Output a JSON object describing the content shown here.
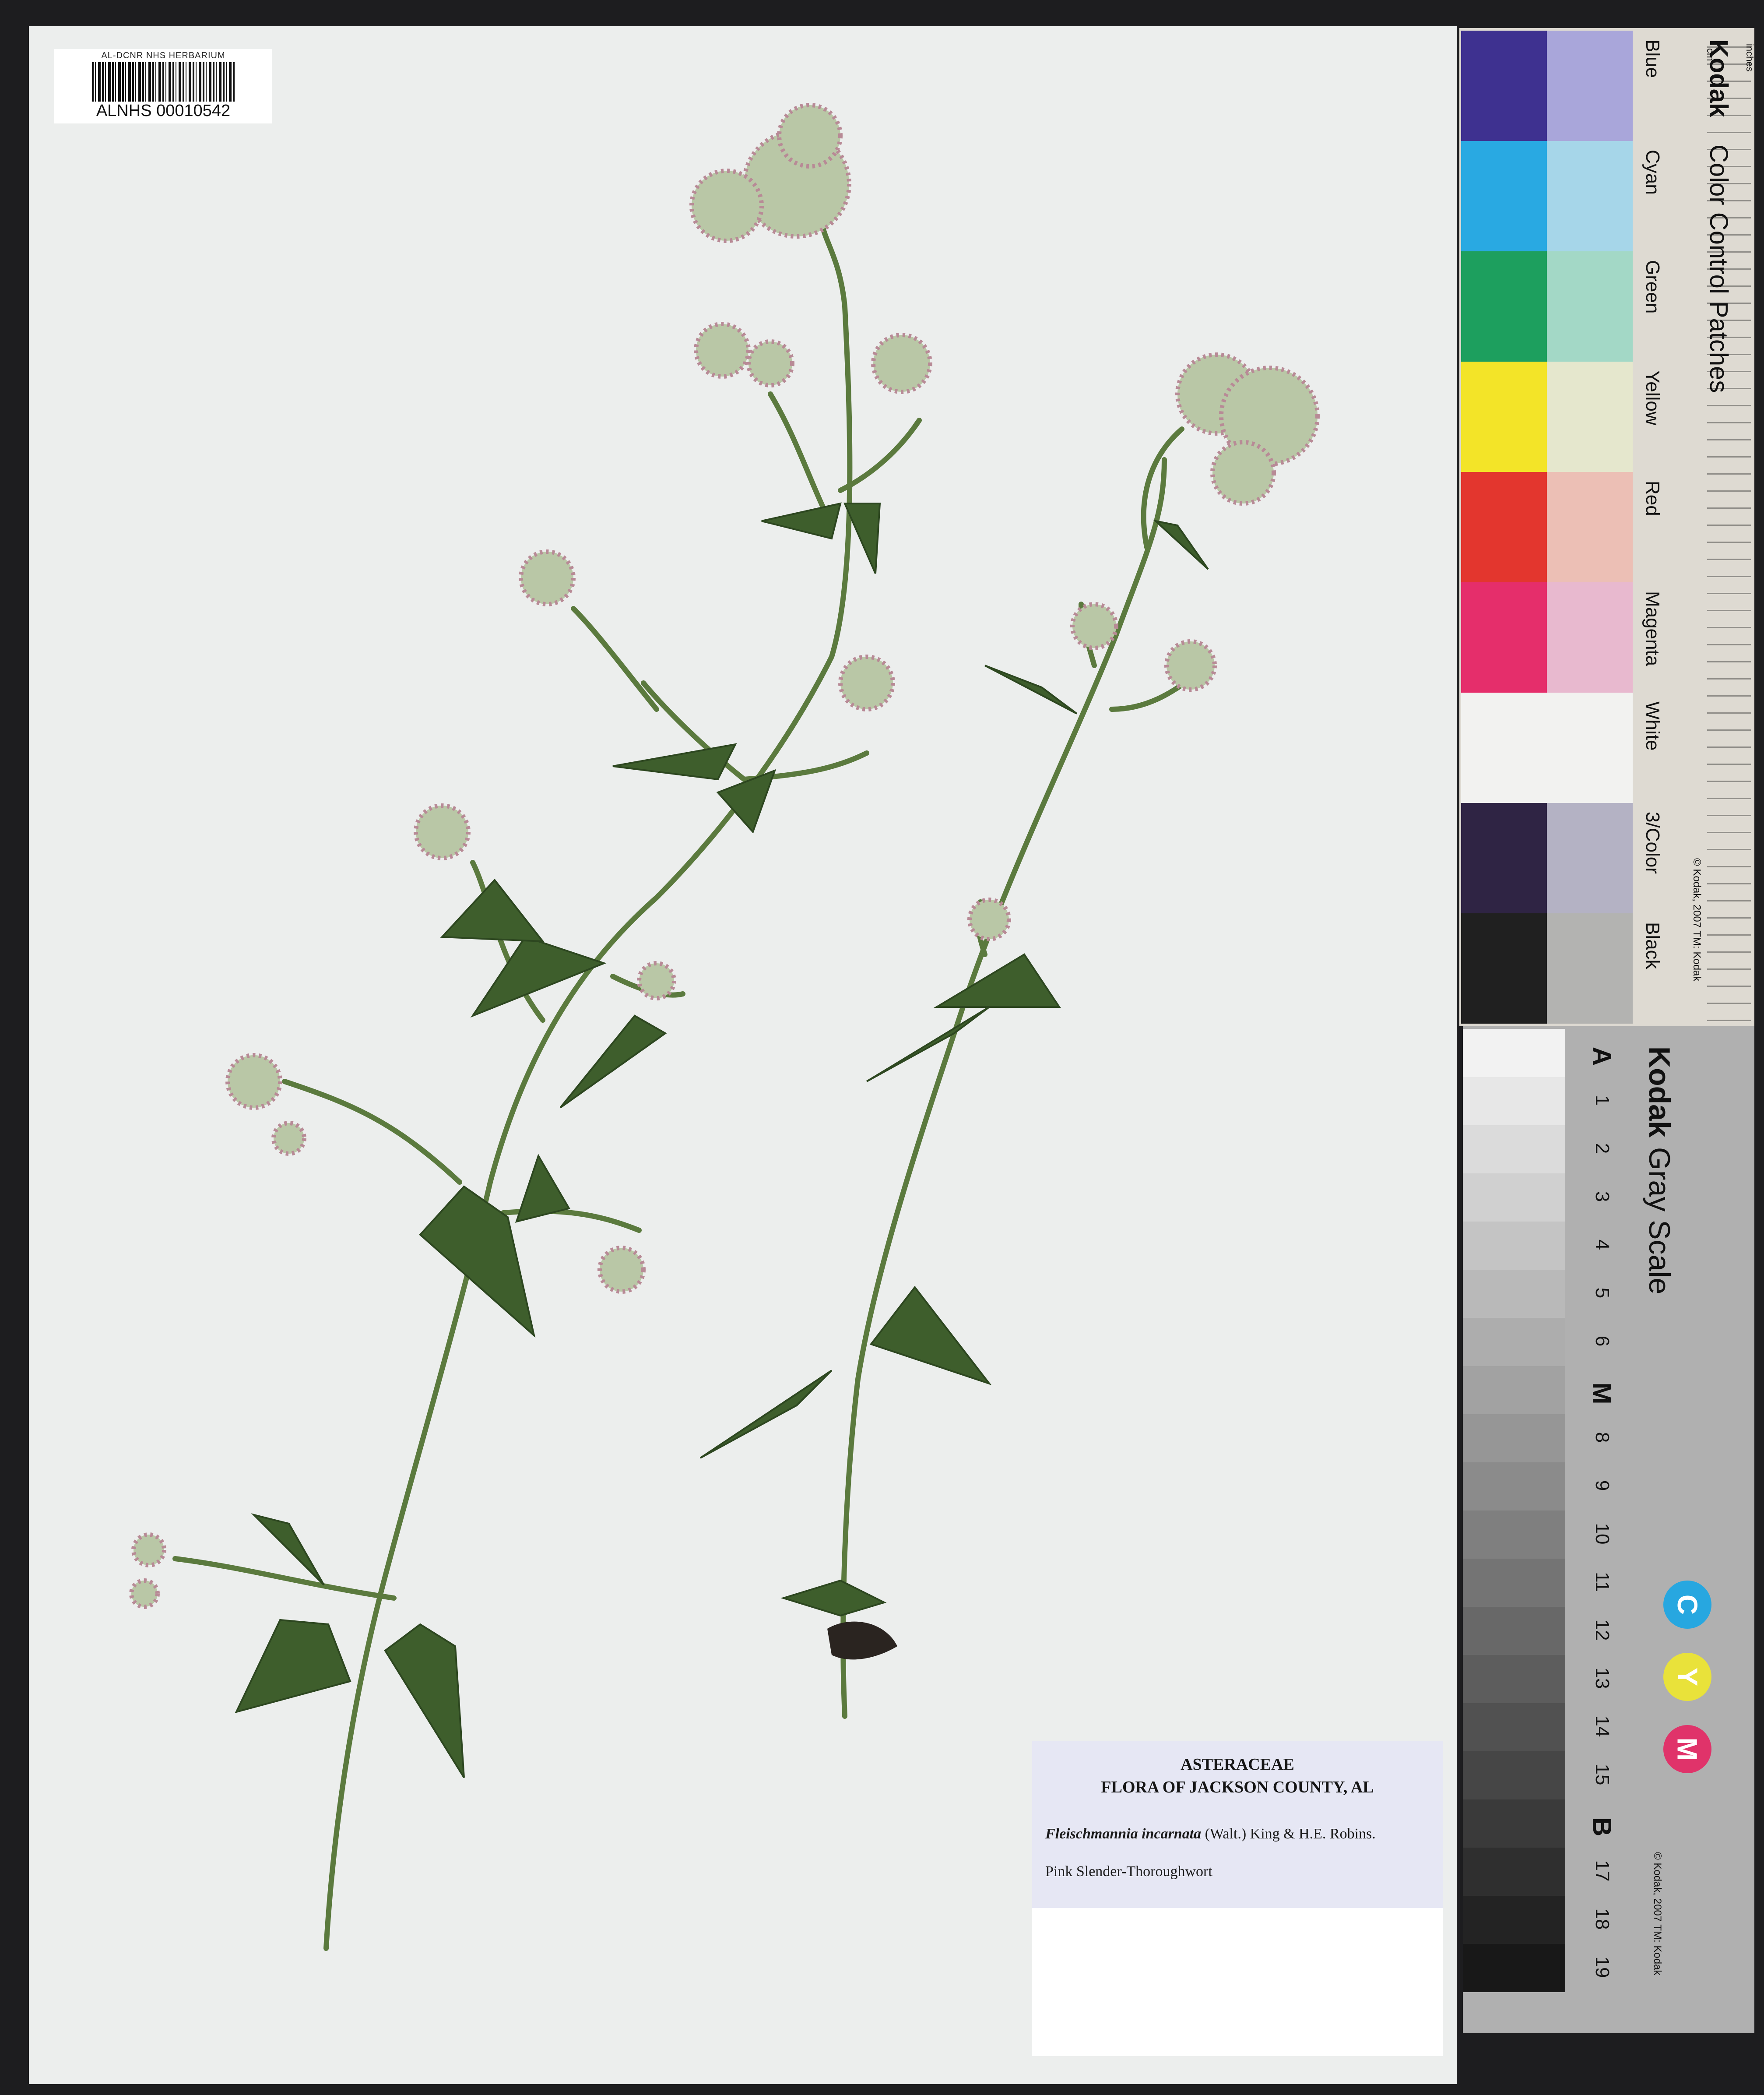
{
  "barcode": {
    "institution": "AL-DCNR NHS HERBARIUM",
    "catalog_number": "ALNHS 00010542"
  },
  "label": {
    "family": "ASTERACEAE",
    "flora": "FLORA OF JACKSON COUNTY, AL",
    "species": "Fleischmannia incarnata",
    "authority": "(Walt.) King & H.E. Robins.",
    "common_name": "Pink Slender-Thoroughwort"
  },
  "color_card": {
    "brand": "Kodak",
    "title": "Color Control Patches",
    "copyright": "© Kodak, 2007  TM: Kodak",
    "ruler_units": [
      "inches",
      "cm"
    ],
    "patches": [
      {
        "name": "Blue",
        "dark": "#3e3190",
        "light": "#a9a6da"
      },
      {
        "name": "Cyan",
        "dark": "#29a9e2",
        "light": "#a6d6e9"
      },
      {
        "name": "Green",
        "dark": "#1d9f5e",
        "light": "#a3d8c6"
      },
      {
        "name": "Yellow",
        "dark": "#f3e428",
        "light": "#e5e7cd"
      },
      {
        "name": "Red",
        "dark": "#e3362e",
        "light": "#ecbfb5"
      },
      {
        "name": "Magenta",
        "dark": "#e52e6b",
        "light": "#e8b9cf"
      },
      {
        "name": "White",
        "dark": "#f2f2f0",
        "light": "#f2f2f0"
      },
      {
        "name": "3/Color",
        "dark": "#2f2444",
        "light": "#b4b2c4"
      },
      {
        "name": "Black",
        "dark": "#202020",
        "light": "#b3b3b1"
      }
    ]
  },
  "gray_card": {
    "brand": "Kodak",
    "title": "Gray Scale",
    "copyright": "© Kodak, 2007  TM: Kodak",
    "steps": [
      "A",
      "1",
      "2",
      "3",
      "4",
      "5",
      "6",
      "M",
      "8",
      "9",
      "10",
      "11",
      "12",
      "13",
      "14",
      "15",
      "B",
      "17",
      "18",
      "19"
    ],
    "cym": [
      {
        "letter": "C",
        "color": "#27a7e0"
      },
      {
        "letter": "Y",
        "color": "#e9e23a"
      },
      {
        "letter": "M",
        "color": "#e0336a"
      }
    ]
  },
  "colors": {
    "sheet": "#eceeed",
    "stem": "#5b7a3e",
    "leaf": "#3e5e2c",
    "flower": "#b9c7a6",
    "flower_pink": "#b88a96"
  }
}
